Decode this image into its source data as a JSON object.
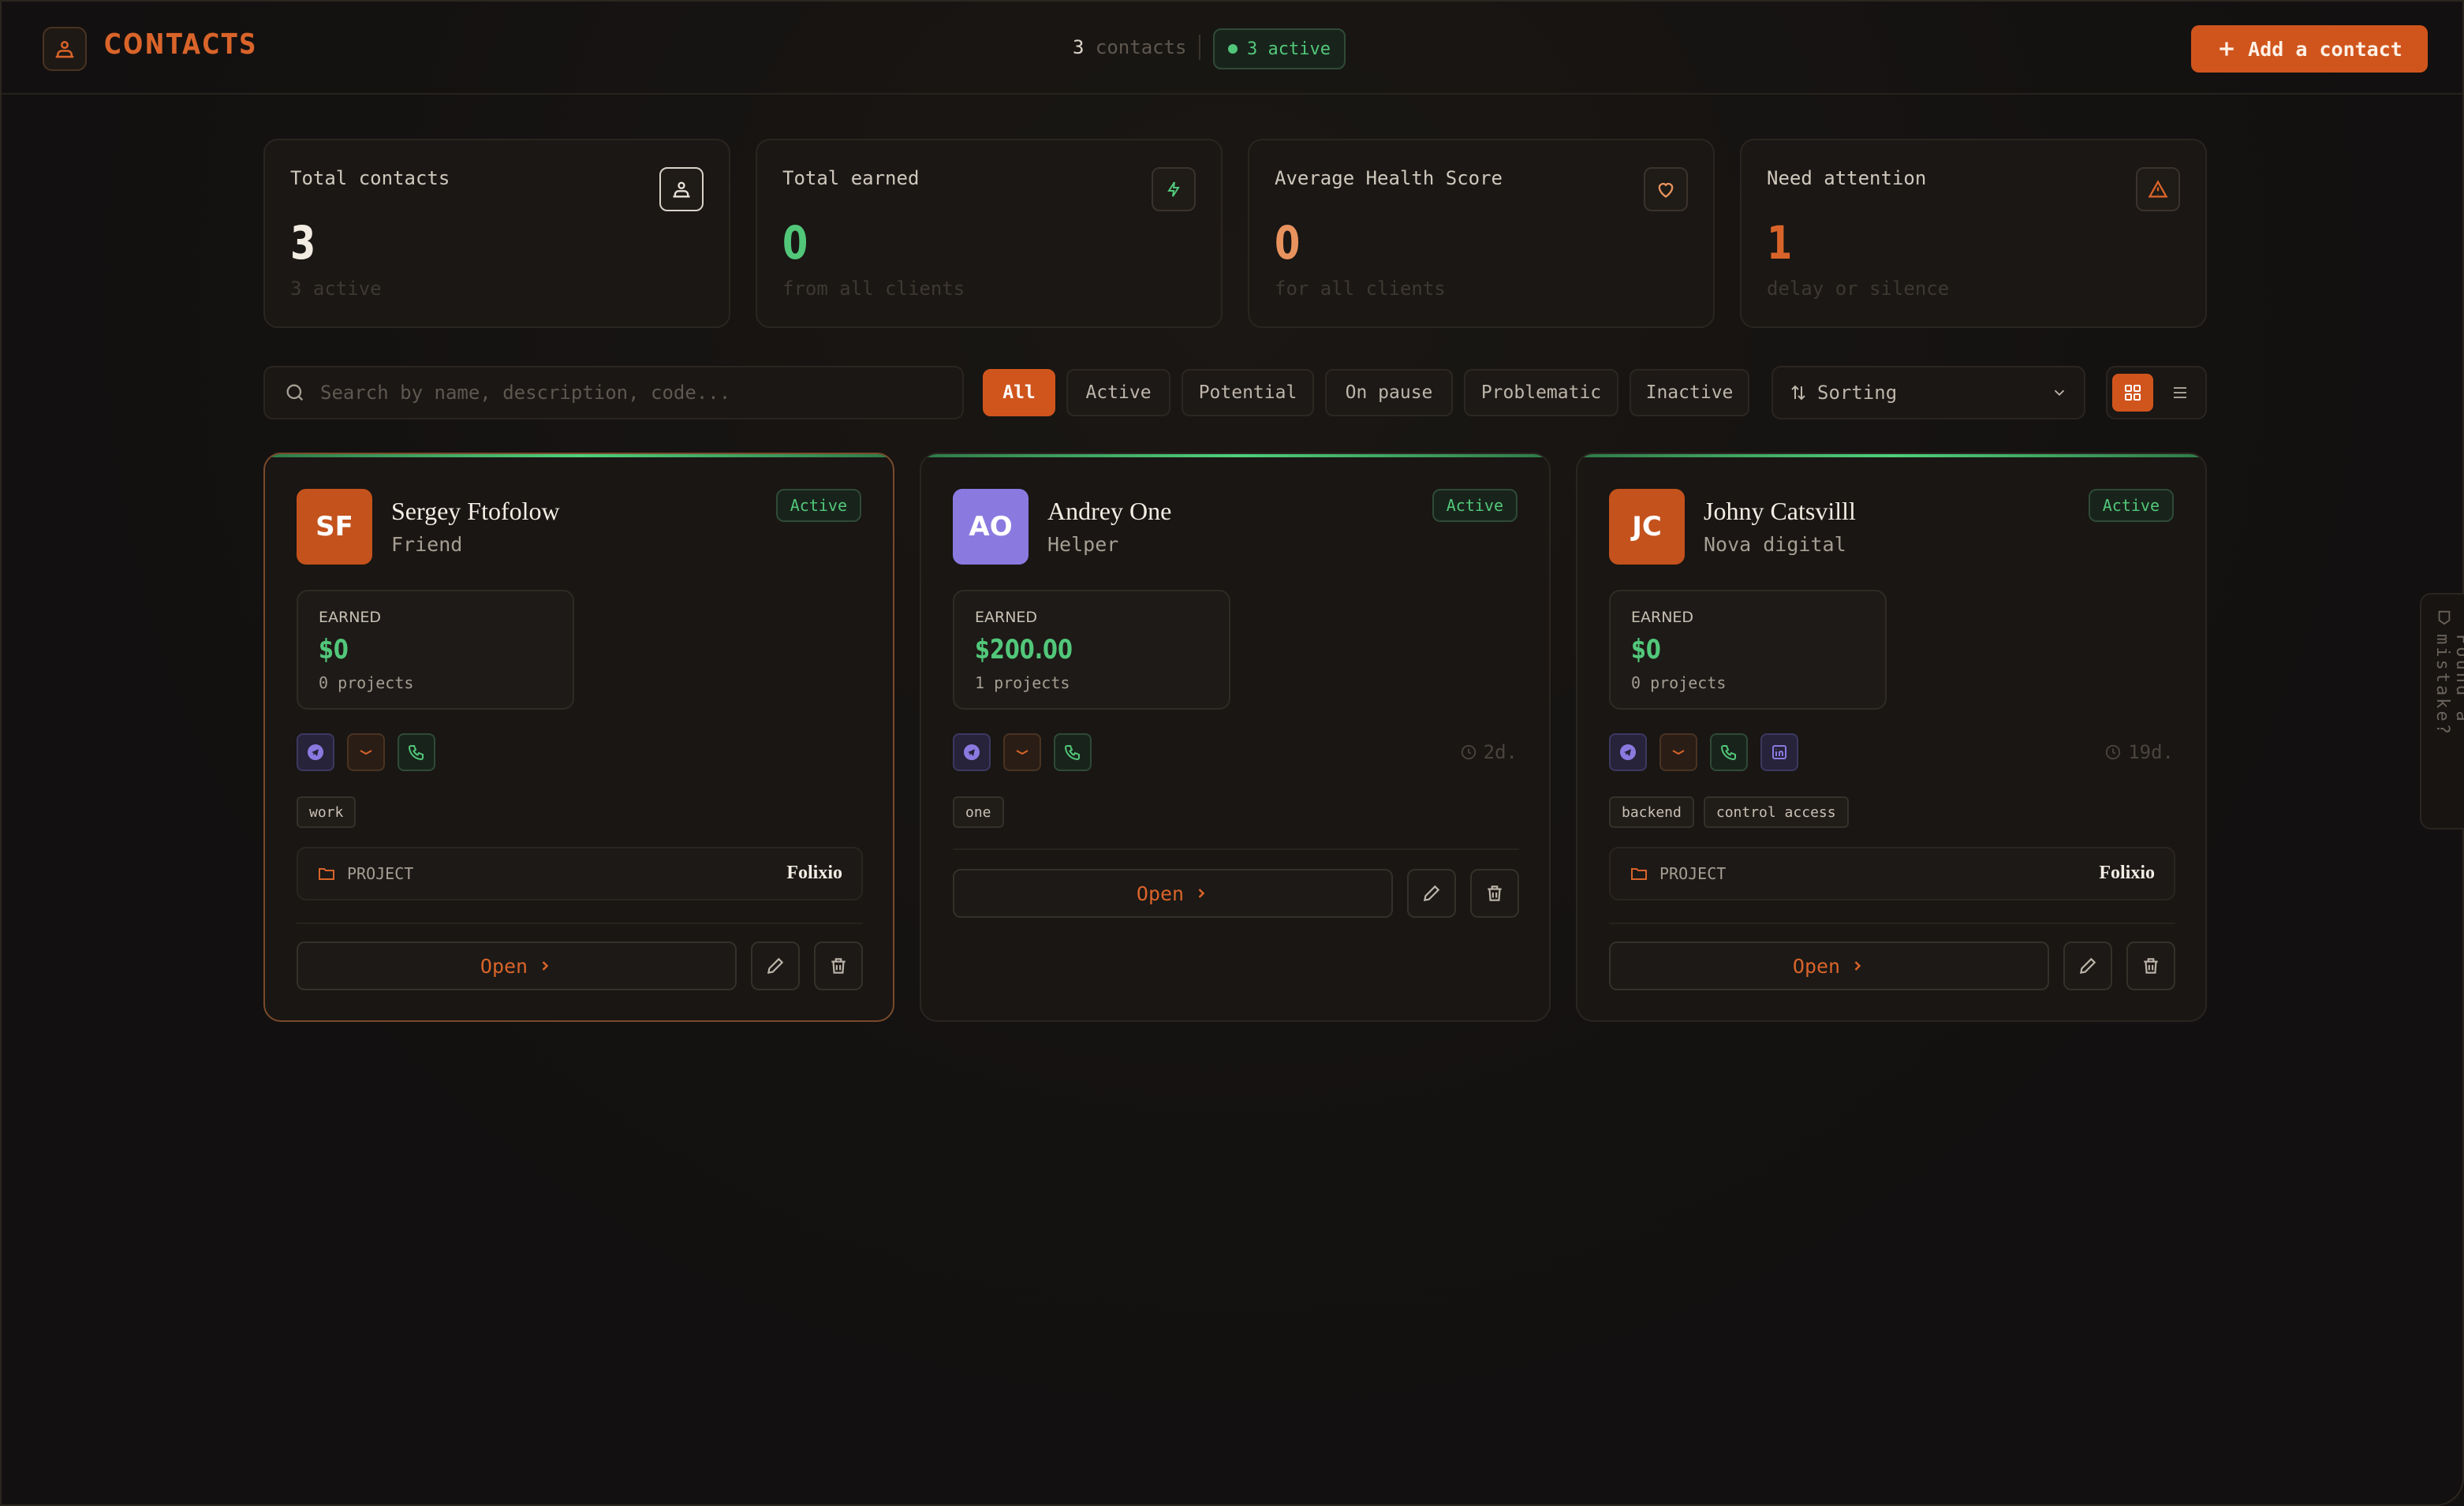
{
  "header": {
    "title": "CONTACTS",
    "count_value": "3",
    "count_label": "contacts",
    "active_badge": "3 active",
    "add_button": "Add a contact"
  },
  "stats": [
    {
      "label": "Total contacts",
      "value": "3",
      "sub": "3 active",
      "color": "#f1ebe2",
      "icon": "contacts-icon"
    },
    {
      "label": "Total earned",
      "value": "0",
      "sub": "from all clients",
      "color": "#52c77a",
      "icon": "lightning-icon"
    },
    {
      "label": "Average Health Score",
      "value": "0",
      "sub": "for all clients",
      "color": "#e8935e",
      "icon": "heart-icon"
    },
    {
      "label": "Need attention",
      "value": "1",
      "sub": "delay or silence",
      "color": "#d9642a",
      "icon": "warning-icon"
    }
  ],
  "filters": {
    "search_placeholder": "Search by name, description, code...",
    "chips": [
      "All",
      "Active",
      "Potential",
      "On pause",
      "Problematic",
      "Inactive"
    ],
    "selected_chip": "All",
    "sort_label": "Sorting",
    "view_mode": "grid"
  },
  "contacts": [
    {
      "initials": "SF",
      "name": "Sergey Ftofolow",
      "role": "Friend",
      "status": "Active",
      "avatar_color": "#c4521c",
      "earned_label": "EARNED",
      "earned_value": "$0",
      "projects": "0 projects",
      "channels": [
        "telegram-icon",
        "mail-icon",
        "phone-icon"
      ],
      "last_seen": "",
      "tags": [
        "work"
      ],
      "project_label": "PROJECT",
      "project_name": "Folixio",
      "open_label": "Open"
    },
    {
      "initials": "AO",
      "name": "Andrey One",
      "role": "Helper",
      "status": "Active",
      "avatar_color": "#8a7ae0",
      "earned_label": "EARNED",
      "earned_value": "$200.00",
      "projects": "1 projects",
      "channels": [
        "telegram-icon",
        "mail-icon",
        "phone-icon"
      ],
      "last_seen": "2d.",
      "tags": [
        "one"
      ],
      "project_label": "",
      "project_name": "",
      "open_label": "Open"
    },
    {
      "initials": "JC",
      "name": "Johny Catsvilll",
      "role": "Nova digital",
      "status": "Active",
      "avatar_color": "#c4521c",
      "earned_label": "EARNED",
      "earned_value": "$0",
      "projects": "0 projects",
      "channels": [
        "telegram-icon",
        "mail-icon",
        "phone-icon",
        "linkedin-icon"
      ],
      "last_seen": "19d.",
      "tags": [
        "backend",
        "control access"
      ],
      "project_label": "PROJECT",
      "project_name": "Folixio",
      "open_label": "Open"
    }
  ],
  "feedback_tab": "Found a mistake?",
  "colors": {
    "accent": "#d0551d",
    "success": "#52c77a",
    "background": "#141210"
  }
}
